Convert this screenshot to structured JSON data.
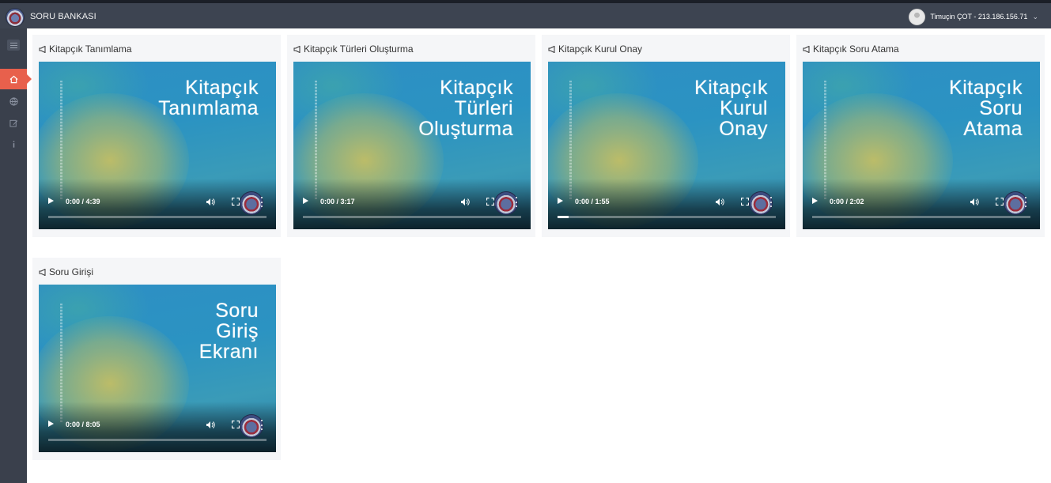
{
  "header": {
    "app_title": "SORU BANKASI",
    "user_label": "Timuçin ÇOT - 213.186.156.71"
  },
  "sidebar": {
    "items": [
      {
        "name": "menu-toggle",
        "icon": "hamburger-icon"
      },
      {
        "name": "home",
        "icon": "home-icon",
        "active": true
      },
      {
        "name": "globe",
        "icon": "globe-icon"
      },
      {
        "name": "edit",
        "icon": "edit-icon"
      },
      {
        "name": "info",
        "icon": "info-icon"
      }
    ],
    "active_color": "#e8604c"
  },
  "cards": [
    {
      "title": "Kitapçık Tanımlama",
      "overlay_lines": [
        "Kitapçık",
        "Tanımlama"
      ],
      "time": "0:00 / 4:39",
      "progress": 0
    },
    {
      "title": "Kitapçık Türleri Oluşturma",
      "overlay_lines": [
        "Kitapçık",
        "Türleri",
        "Oluşturma"
      ],
      "time": "0:00 / 3:17",
      "progress": 0
    },
    {
      "title": "Kitapçık Kurul Onay",
      "overlay_lines": [
        "Kitapçık",
        "Kurul",
        "Onay"
      ],
      "time": "0:00 / 1:55",
      "progress": 0.05
    },
    {
      "title": "Kitapçık Soru Atama",
      "overlay_lines": [
        "Kitapçık",
        "Soru",
        "Atama"
      ],
      "time": "0:00 / 2:02",
      "progress": 0
    },
    {
      "title": "Soru Girişi",
      "overlay_lines": [
        "Soru",
        "Giriş",
        "Ekranı"
      ],
      "time": "0:00 / 8:05",
      "progress": 0
    }
  ]
}
